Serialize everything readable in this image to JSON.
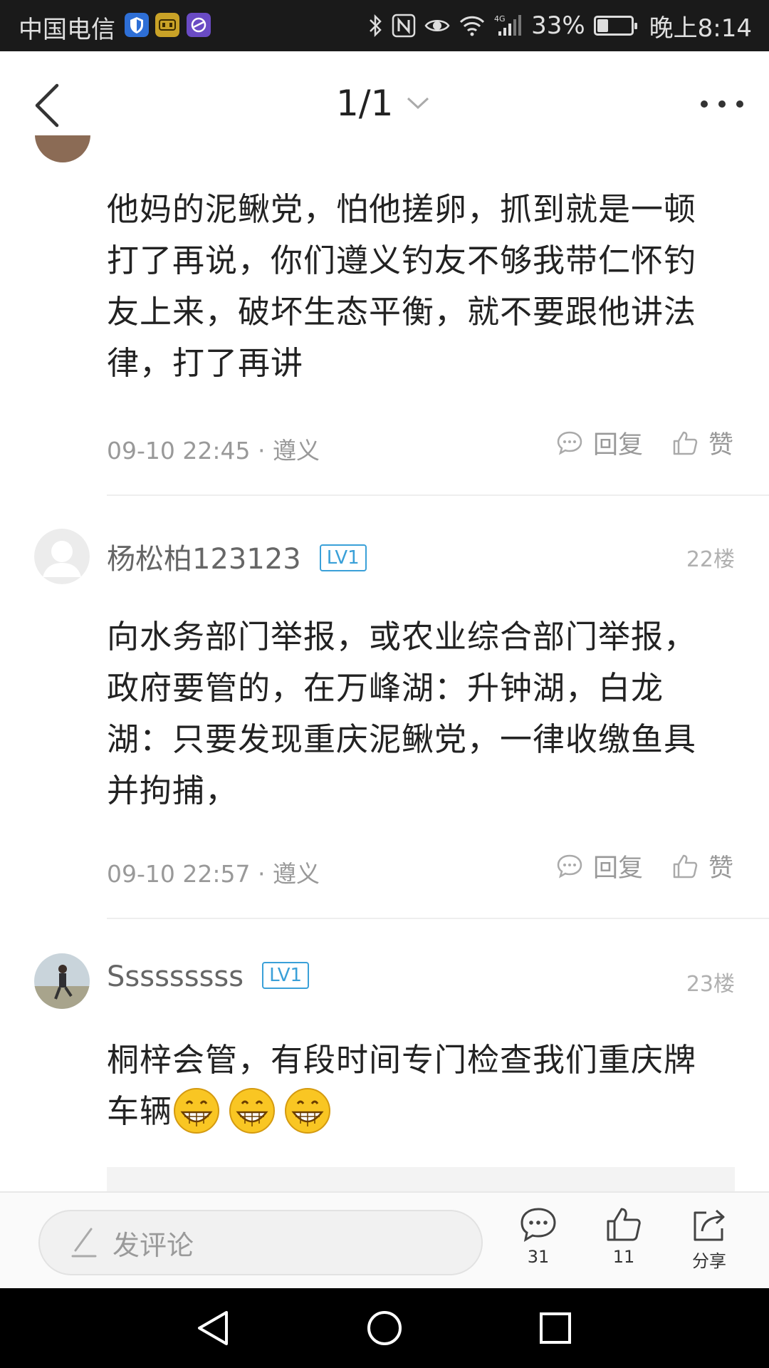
{
  "status_bar": {
    "carrier": "中国电信",
    "battery_percent": "33%",
    "battery_level": 0.33,
    "time": "晚上8:14",
    "icons": [
      "shield-app-icon",
      "game-app-icon",
      "browser-app-icon",
      "bluetooth-icon",
      "nfc-icon",
      "eye-icon",
      "wifi-icon",
      "4g-signal-icon",
      "battery-icon"
    ]
  },
  "header": {
    "page_indicator": "1/1",
    "icons": [
      "back-arrow-icon",
      "chevron-down-icon",
      "more-dots-icon"
    ]
  },
  "comments": [
    {
      "text": "他妈的泥鳅党，怕他搓卵，抓到就是一顿打了再说，你们遵义钓友不够我带仁怀钓友上来，破坏生态平衡，就不要跟他讲法律，打了再讲",
      "lines": [
        "他妈的泥鳅党，怕他搓卵，抓到就是一顿",
        "打了再说，你们遵义钓友不够我带仁怀钓",
        "友上来，破坏生态平衡，就不要跟他讲法",
        "律，打了再讲"
      ],
      "meta": "09-10 22:45 · 遵义",
      "reply_label": "回复",
      "like_label": "赞"
    },
    {
      "username": "杨松柏123123",
      "level": "LV1",
      "floor": "22楼",
      "lines": [
        "向水务部门举报，或农业综合部门举报，",
        "政府要管的，在万峰湖：升钟湖，白龙",
        "湖：只要发现重庆泥鳅党，一律收缴鱼具",
        "并拘捕，"
      ],
      "meta": "09-10 22:57 · 遵义",
      "reply_label": "回复",
      "like_label": "赞"
    },
    {
      "username": "Sssssssss",
      "level": "LV1",
      "floor": "23楼",
      "lines": [
        "桐梓会管，有段时间专门检查我们重庆牌",
        "车辆"
      ],
      "emojis": [
        "grin-emoji",
        "grin-emoji",
        "grin-emoji"
      ]
    }
  ],
  "bottom_bar": {
    "comment_placeholder": "发评论",
    "comment_count": "31",
    "like_count": "11",
    "share_label": "分享"
  },
  "nav_bar": {
    "icons": [
      "nav-back-icon",
      "nav-home-icon",
      "nav-recents-icon"
    ]
  }
}
